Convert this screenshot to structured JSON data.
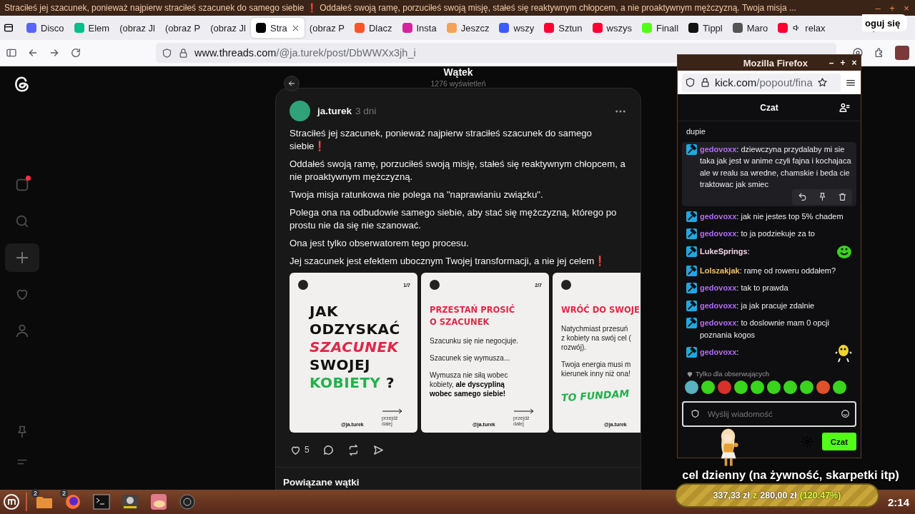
{
  "window": {
    "title": "Straciłeś jej szacunek, ponieważ najpierw straciłeś szacunek do samego siebie ❗ Oddałeś swoją ramę, porzuciłeś swoją misję, stałeś się reaktywnym chłopcem, a nie proaktywnym mężczyzną. Twoja misja ...",
    "controls": [
      "–",
      "+",
      "×"
    ]
  },
  "tabs": [
    {
      "label": "Disco",
      "color": "#5865f2",
      "selected": false,
      "audio": false
    },
    {
      "label": "Elem",
      "color": "#0dbd8b",
      "selected": false,
      "audio": false
    },
    {
      "label": "(obraz Jl",
      "selected": false,
      "audio": false
    },
    {
      "label": "(obraz P",
      "selected": false,
      "audio": false
    },
    {
      "label": "(obraz Jl",
      "selected": false,
      "audio": false
    },
    {
      "label": "Stra",
      "color": "#000000",
      "selected": true,
      "audio": false
    },
    {
      "label": "(obraz P",
      "selected": false,
      "audio": false
    },
    {
      "label": "Dlacz",
      "color": "#fb542b",
      "selected": false,
      "audio": false
    },
    {
      "label": "Insta",
      "color": "#d6249f",
      "selected": false,
      "audio": false
    },
    {
      "label": "Jeszcz",
      "color": "#f4a259",
      "selected": false,
      "audio": false
    },
    {
      "label": "wszy",
      "color": "#3d5afe",
      "selected": false,
      "audio": false
    },
    {
      "label": "Sztun",
      "color": "#ff0033",
      "selected": false,
      "audio": false
    },
    {
      "label": "wszys",
      "color": "#ff0033",
      "selected": false,
      "audio": false
    },
    {
      "label": "Finall",
      "color": "#53fc18",
      "selected": false,
      "audio": false
    },
    {
      "label": "Tippl",
      "color": "#111111",
      "selected": false,
      "audio": false
    },
    {
      "label": "Maro",
      "color": "#555555",
      "selected": false,
      "audio": false
    },
    {
      "label": "relax",
      "color": "#ff0033",
      "selected": false,
      "audio": true
    }
  ],
  "address_bar": {
    "domain": "www.threads.com",
    "path": "/@ja.turek/post/DbWWXx3jh_i"
  },
  "sidebar": {
    "items": [
      {
        "kind": "feed",
        "selected": false,
        "badge": true
      },
      {
        "kind": "search",
        "selected": false,
        "badge": false
      },
      {
        "kind": "create",
        "selected": true,
        "badge": false
      },
      {
        "kind": "activity",
        "selected": false,
        "badge": false
      },
      {
        "kind": "profile",
        "selected": false,
        "badge": false
      }
    ]
  },
  "header": {
    "title": "Wątek",
    "views": "1276 wyświetleń",
    "login": "oguj się"
  },
  "post": {
    "author": "ja.turek",
    "time": "3 dni",
    "paragraphs": [
      "Straciłeś jej szacunek, ponieważ najpierw straciłeś szacunek do samego siebie❗",
      "Oddałeś swoją ramę, porzuciłeś swoją misję, stałeś się reaktywnym chłopcem, a nie proaktywnym mężczyzną.",
      "Twoja misja ratunkowa nie polega na \"naprawianiu związku\".",
      "Polega ona na odbudowie samego siebie, aby stać się mężczyzną, którego po prostu nie da się nie szanować.",
      "Ona jest tylko obserwatorem tego procesu.",
      "Jej szacunek jest efektem ubocznym Twojej transformacji, a nie jej celem❗"
    ],
    "slides": [
      {
        "kind": "cover",
        "page": "1/7",
        "lines": [
          [
            {
              "text": "JAK",
              "kind": "dark"
            }
          ],
          [
            {
              "text": "ODZYSKAĆ",
              "kind": "dark"
            }
          ],
          [
            {
              "text": "SZACUNEK",
              "kind": "red"
            }
          ],
          [
            {
              "text": "SWOJEJ",
              "kind": "dark"
            }
          ],
          [
            {
              "text": "KOBIETY",
              "kind": "green"
            },
            {
              "text": "?",
              "kind": "dark"
            }
          ]
        ],
        "handle": "@ja.turek",
        "next": "przejdź\ndalej"
      },
      {
        "kind": "text",
        "page": "2/7",
        "heading": "PRZESTAŃ PROSIĆ\nO SZACUNEK",
        "paragraphs": [
          "Szacunku się nie negocjuje.",
          "Szacunek się wymusza...",
          "Wymusza nie siłą wobec\nkobiety, **ale dyscypliną\nwobec samego siebie!**"
        ],
        "handle": "@ja.turek",
        "next": "przejdź\ndalej"
      },
      {
        "kind": "text",
        "heading": "WRÓĆ DO SWOJE",
        "paragraphs": [
          "Natychmiast przesuń\nz kobiety na swój cel (\nrozwój).",
          "Twoja energia musi m\nkierunek inny niż ona!"
        ],
        "closing": "TO FUNDAM",
        "handle": "@ja.turek"
      }
    ],
    "likes": "5"
  },
  "related": {
    "title": "Powiązane wątki"
  },
  "chat_window": {
    "title": "Mozilla Firefox",
    "controls": [
      "–",
      "+",
      "×"
    ],
    "url_domain": "kick.com",
    "url_path": "/popout/fina",
    "header": "Czat",
    "messages": [
      {
        "kind": "continuation",
        "text": "dupie",
        "hovered": false
      },
      {
        "kind": "text",
        "user": "gedovoxx",
        "color": "#b36bf5",
        "text": ": dziewczyna przydalaby mi sie taka jak jest w anime czyli fajna i kochajaca ale w realu sa wredne, chamskie i beda cie traktowac jak smiec",
        "hovered": true
      },
      {
        "kind": "text",
        "user": "gedovoxx",
        "color": "#b36bf5",
        "text": ": jak nie jestes top 5% chadem",
        "hovered": false
      },
      {
        "kind": "text",
        "user": "gedovoxx",
        "color": "#b36bf5",
        "text": ": to ja podziekuje za to",
        "hovered": false
      },
      {
        "kind": "blob",
        "user": "LukeSprings",
        "color": "#f4d4e4",
        "text": ":",
        "hovered": false
      },
      {
        "kind": "text",
        "user": "Lolszakjak",
        "color": "#f5c26b",
        "text": ": ramę od roweru oddałem?",
        "hovered": false
      },
      {
        "kind": "text",
        "user": "gedovoxx",
        "color": "#b36bf5",
        "text": ": tak to prawda",
        "hovered": false
      },
      {
        "kind": "text",
        "user": "gedovoxx",
        "color": "#b36bf5",
        "text": ": ja jak pracuje zdalnie",
        "hovered": false
      },
      {
        "kind": "text",
        "user": "gedovoxx",
        "color": "#b36bf5",
        "text": ": to doslownie mam 0 opcji poznania kogos",
        "hovered": false
      },
      {
        "kind": "figure",
        "user": "gedovoxx",
        "color": "#b36bf5",
        "text": ":",
        "hovered": false
      }
    ],
    "followers_only": "Tylko dla obserwujących",
    "input_placeholder": "Wyślij wiadomość",
    "send": "Czat"
  },
  "taskbar": {
    "apps": [
      {
        "kind": "folder",
        "badge": "2"
      },
      {
        "kind": "firefox",
        "badge": "2"
      },
      {
        "kind": "terminal"
      },
      {
        "kind": "steam"
      },
      {
        "kind": "app"
      },
      {
        "kind": "obs"
      }
    ],
    "clock": "2:14"
  },
  "goal": {
    "title": "cel dzienny (na żywność, skarpetki itp)",
    "current": "337,33 zł",
    "separator": "z",
    "target": "280,00 zł",
    "percent": "(120.47%)",
    "level": 1
  }
}
